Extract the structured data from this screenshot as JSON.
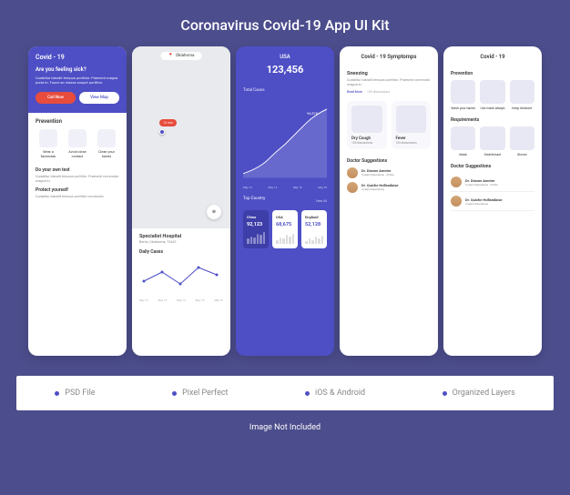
{
  "title": "Coronavirus Covid-19 App UI Kit",
  "screen1": {
    "appname": "Covid - 19",
    "question": "Are you feeling sick?",
    "desc": "Curabitur blandit tempus porttitor. Praesent magna porta in. Fusce ac massa suspot porttitor.",
    "call_btn": "Call Now",
    "map_btn": "View Map",
    "prevention_title": "Prevention",
    "prev_items": [
      "Wear a facemask",
      "Avoid close contact",
      "Clean your hands"
    ],
    "tip1_title": "Do your own test",
    "tip1_text": "Curabitur blandit tempus porttitor. Praesent commodo magna in.",
    "tip2_title": "Protect yourself",
    "tip2_text": "Curabitur blandit tempus porttitor commodo."
  },
  "screen2": {
    "location": "Oklahoma",
    "distance": "12 min",
    "hospital": "Specialist Hospital",
    "address": "Berlin, Oklahoma, 73401",
    "daily_title": "Daily Cases",
    "dates": [
      "May 12",
      "May 13",
      "May 14",
      "May 15",
      "May 16"
    ]
  },
  "screen3": {
    "country": "USA",
    "total": "123,456",
    "total_label": "Total Cases",
    "peak": "94,578",
    "dates": [
      "May 12",
      "May 14",
      "May 16",
      "May 18"
    ],
    "top_title": "Top Country",
    "view_all": "View All",
    "cards": [
      {
        "country": "China",
        "num": "92,123"
      },
      {
        "country": "USA",
        "num": "68,675"
      },
      {
        "country": "England",
        "num": "52,128"
      }
    ]
  },
  "screen4": {
    "header": "Covid - 19 Symptomps",
    "sneezing_title": "Sneezing",
    "sneezing_desc": "Curabitur blandit tempus porttitor. Praesent commodo magna in.",
    "read_more": "Read More",
    "discussions": "105 discussions",
    "symptoms": [
      {
        "name": "Dry Cough",
        "sub": "105 discussions"
      },
      {
        "name": "Fever",
        "sub": "105 discussions"
      }
    ],
    "doc_title": "Doctor Suggestions",
    "doctors": [
      {
        "name": "Dr. Dianne Ameter",
        "sub": "5 years Experience · Online"
      },
      {
        "name": "Dr. Quiche Hollandaise",
        "sub": "3 years Experience"
      }
    ]
  },
  "screen5": {
    "header": "Covid - 19",
    "prevention_title": "Prevention",
    "prevention": [
      "Wash your hands",
      "Use mask always",
      "Keep distance"
    ],
    "req_title": "Requirements",
    "requirements": [
      "Mask",
      "Disinfectant",
      "Gloves"
    ],
    "doc_title": "Doctor Suggestions",
    "doctors": [
      {
        "name": "Dr. Dianne Ameter",
        "sub": "5 years Experience · Online"
      },
      {
        "name": "Dr. Quiche Hollandaise",
        "sub": "3 years Experience"
      }
    ]
  },
  "features": [
    "PSD File",
    "Pixel Perfect",
    "iOS & Android",
    "Organized Layers"
  ],
  "disclaimer": "Image Not Included",
  "chart_data": [
    {
      "type": "line",
      "title": "Daily Cases",
      "categories": [
        "May 12",
        "May 13",
        "May 14",
        "May 15",
        "May 16"
      ],
      "values": [
        20,
        35,
        22,
        40,
        32
      ]
    },
    {
      "type": "area",
      "title": "Total Cases",
      "categories": [
        "May 12",
        "May 14",
        "May 16",
        "May 18"
      ],
      "values": [
        10,
        25,
        40,
        95
      ],
      "peak_label": "94,578"
    }
  ]
}
